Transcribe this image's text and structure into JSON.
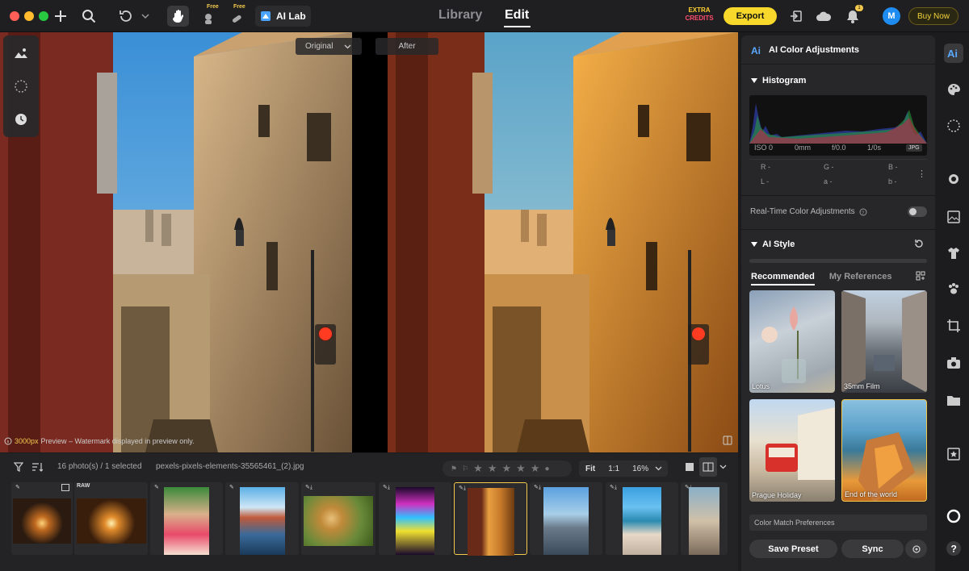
{
  "topbar": {
    "free_badge_1": "Free",
    "free_badge_2": "Free",
    "ai_lab_label": "AI Lab",
    "nav_library": "Library",
    "nav_edit": "Edit",
    "extra_credits_line1": "EXTRA",
    "extra_credits_line2": "CREDITS",
    "export_label": "Export",
    "notification_count": "1",
    "avatar_letter": "M",
    "buy_now_label": "Buy Now"
  },
  "canvas": {
    "original_label": "Original",
    "after_label": "After",
    "watermark_size": "3000px",
    "watermark_text": "Preview – Watermark displayed in preview only."
  },
  "filmstrip": {
    "photo_count": "16 photo(s) / 1 selected",
    "filename": "pexels-pixels-elements-35565461_(2).jpg",
    "zoom_fit": "Fit",
    "zoom_1to1": "1:1",
    "zoom_percent": "16%",
    "raw_label": "RAW",
    "rating_stars": 0,
    "thumbnails": [
      {
        "name": "tunnel-light",
        "selected": false
      },
      {
        "name": "tunnel-raw",
        "selected": false
      },
      {
        "name": "child-colors",
        "selected": false
      },
      {
        "name": "city-reflection",
        "selected": false
      },
      {
        "name": "puppies",
        "selected": false
      },
      {
        "name": "neon-sign",
        "selected": false
      },
      {
        "name": "street-alley",
        "selected": true
      },
      {
        "name": "city-skyline",
        "selected": false
      },
      {
        "name": "beach",
        "selected": false
      },
      {
        "name": "coast-partial",
        "selected": false
      }
    ]
  },
  "panel": {
    "title": "AI Color Adjustments",
    "histogram_title": "Histogram",
    "exif": {
      "iso": "ISO 0",
      "focal": "0mm",
      "aperture": "f/0.0",
      "shutter": "1/0s",
      "format": "JPG"
    },
    "rgb": {
      "r": "R -",
      "g": "G -",
      "b": "B -",
      "l": "L -",
      "a": "a -",
      "bb": "b -"
    },
    "realtime_label": "Real-Time Color Adjustments",
    "realtime_enabled": false,
    "ai_style_title": "AI Style",
    "tab_recommended": "Recommended",
    "tab_references": "My References",
    "styles": [
      {
        "label": "Lotus",
        "selected": false
      },
      {
        "label": "35mm Film",
        "selected": false
      },
      {
        "label": "Prague Holiday",
        "selected": false
      },
      {
        "label": "End of the world",
        "selected": true
      }
    ],
    "color_match_label": "Color Match Preferences",
    "save_preset_label": "Save Preset",
    "sync_label": "Sync"
  },
  "colors": {
    "accent": "#f8d82b",
    "avatar": "#1e8cf0",
    "panel_bg": "#27272a"
  }
}
